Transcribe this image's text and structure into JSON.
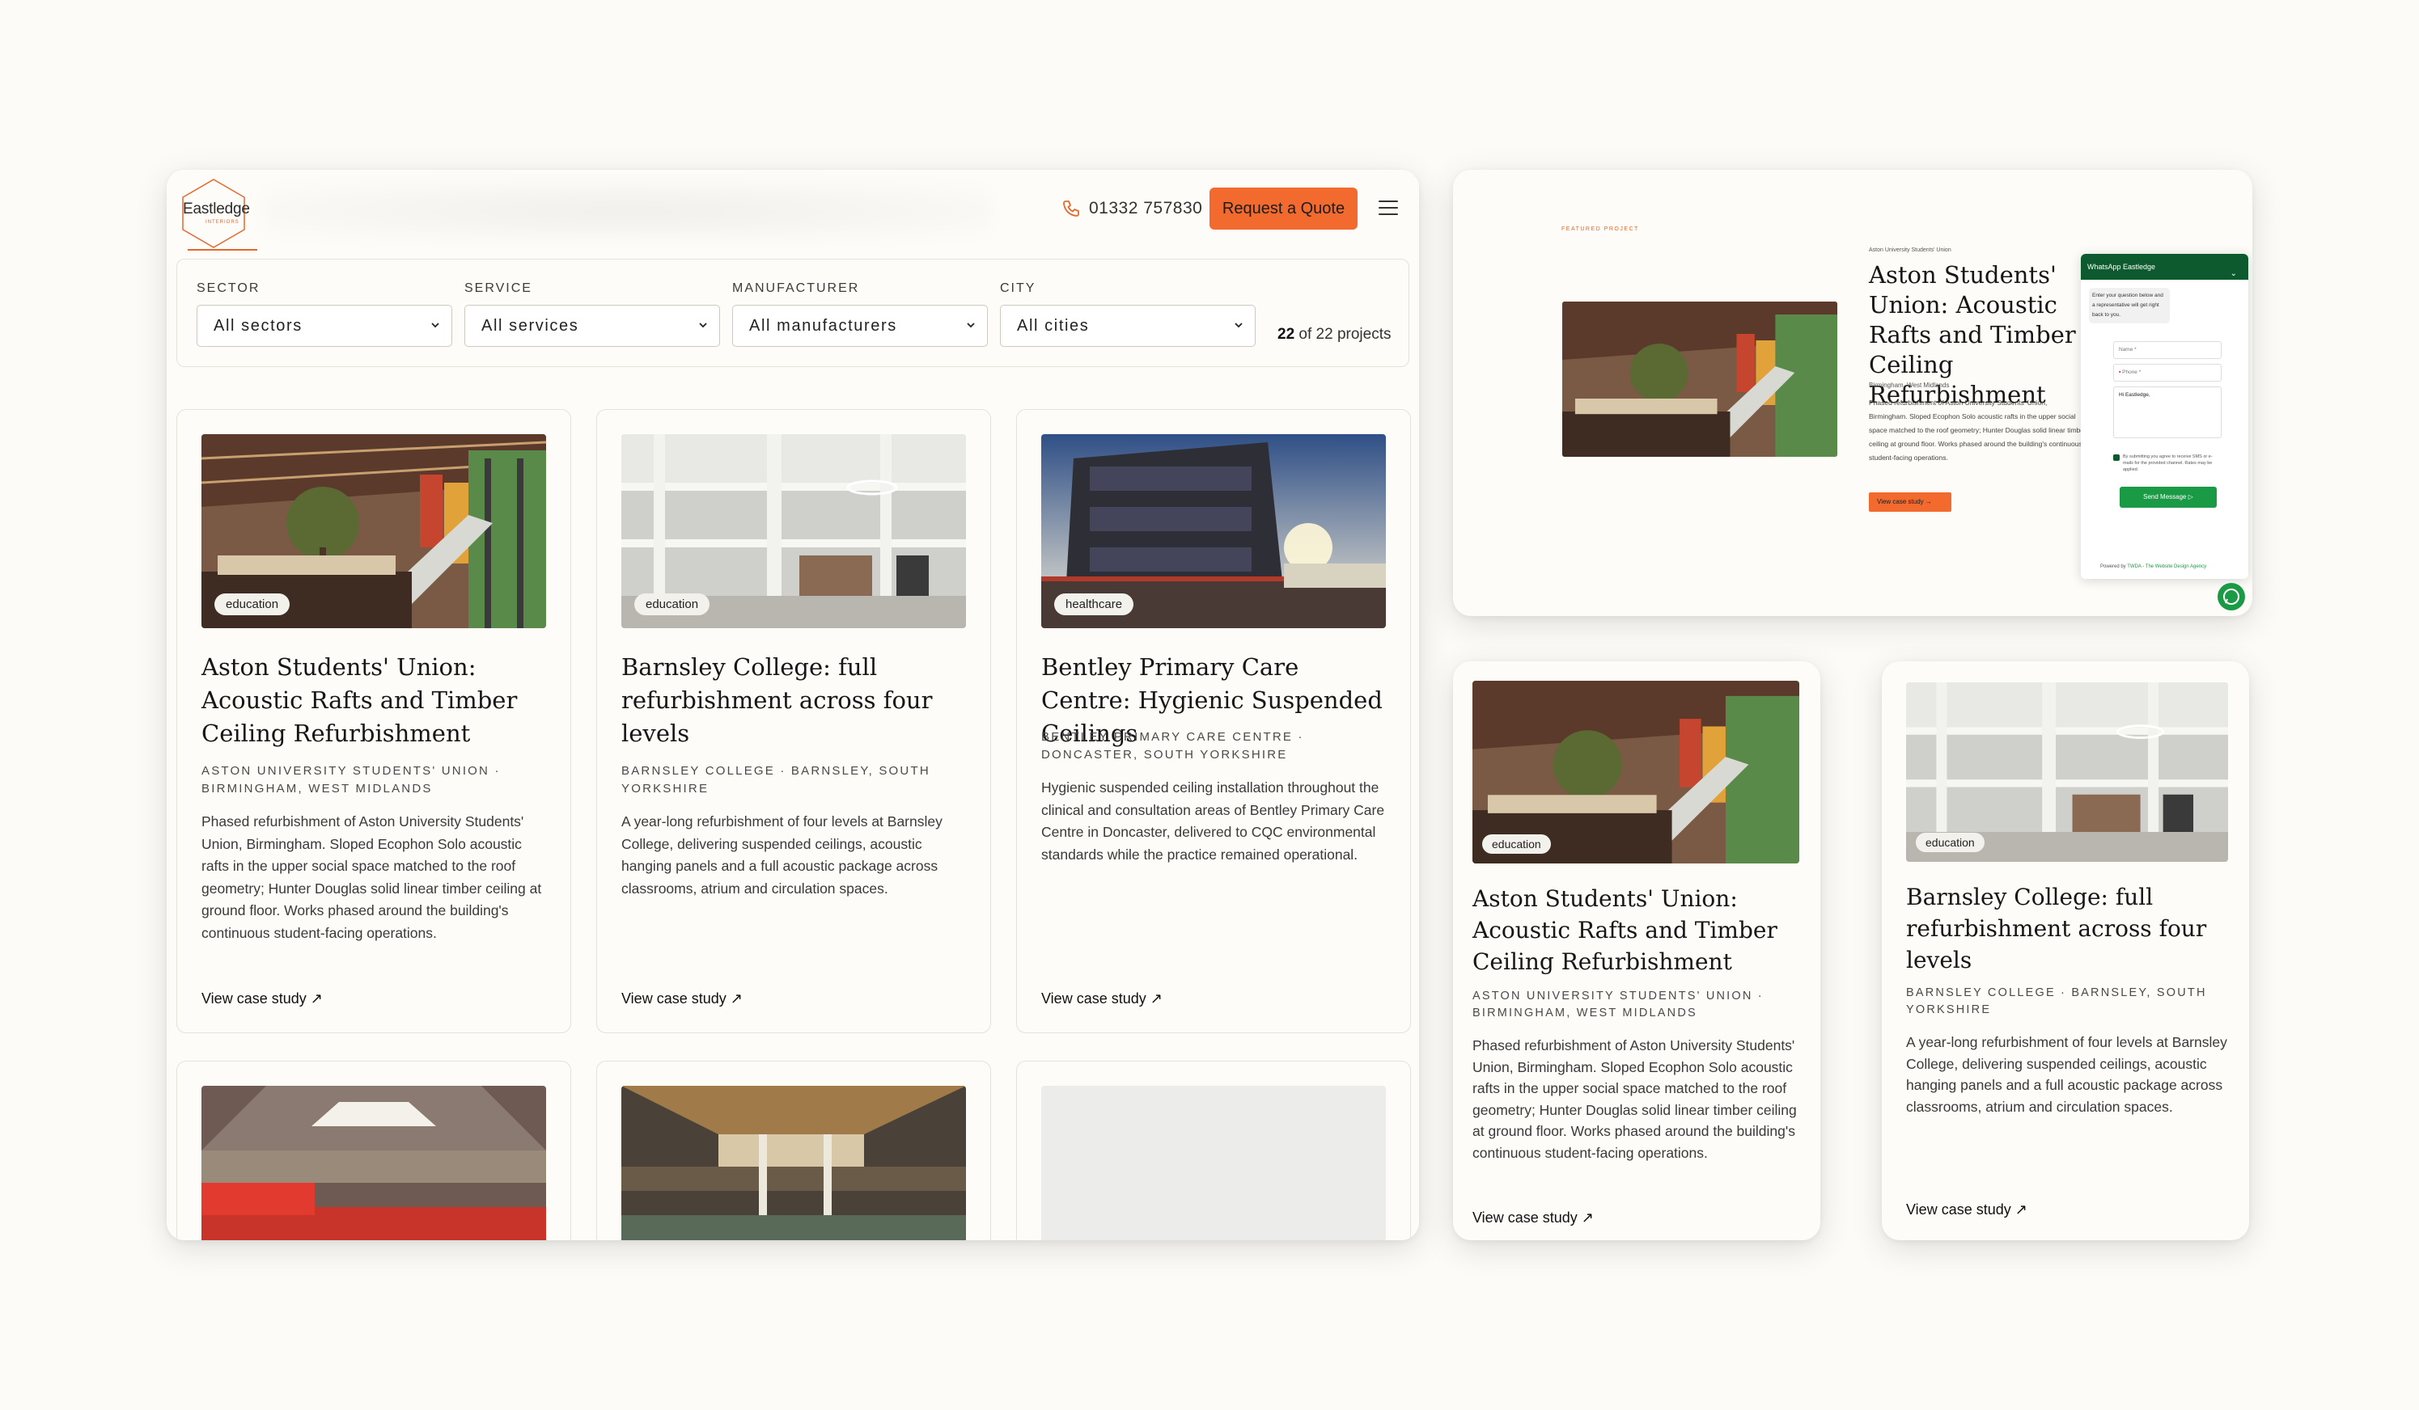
{
  "header": {
    "logo_text": "Eastledge",
    "logo_sub": "INTERIORS",
    "phone": "01332 757830",
    "cta": "Request a Quote"
  },
  "filters": {
    "sector": {
      "label": "SECTOR",
      "value": "All sectors"
    },
    "service": {
      "label": "SERVICE",
      "value": "All services"
    },
    "manufacturer": {
      "label": "MANUFACTURER",
      "value": "All manufacturers"
    },
    "city": {
      "label": "CITY",
      "value": "All cities"
    },
    "count": "22",
    "count_suffix": "of 22 projects"
  },
  "cards": [
    {
      "badge": "education",
      "title": "Aston Students' Union: Acoustic Rafts and Timber Ceiling Refurbishment",
      "meta": "ASTON UNIVERSITY STUDENTS' UNION · BIRMINGHAM, WEST MIDLANDS",
      "desc": "Phased refurbishment of Aston University Students' Union, Birmingham. Sloped Ecophon Solo acoustic rafts in the upper social space matched to the roof geometry; Hunter Douglas solid linear timber ceiling at ground floor. Works phased around the building's continuous student-facing operations.",
      "cta": "View case study ↗"
    },
    {
      "badge": "education",
      "title": "Barnsley College: full refurbishment across four levels",
      "meta": "BARNSLEY COLLEGE · BARNSLEY, SOUTH YORKSHIRE",
      "desc": "A year-long refurbishment of four levels at Barnsley College, delivering suspended ceilings, acoustic hanging panels and a full acoustic package across classrooms, atrium and circulation spaces.",
      "cta": "View case study ↗"
    },
    {
      "badge": "healthcare",
      "title": "Bentley Primary Care Centre: Hygienic Suspended Ceilings",
      "meta": "BENTLEY PRIMARY CARE CENTRE · DONCASTER, SOUTH YORKSHIRE",
      "desc": "Hygienic suspended ceiling installation throughout the clinical and consultation areas of Bentley Primary Care Centre in Doncaster, delivered to CQC environmental standards while the practice remained operational.",
      "cta": "View case study ↗"
    }
  ],
  "featured": {
    "kicker": "FEATURED PROJECT",
    "org": "Aston University Students' Union",
    "title": "Aston Students' Union: Acoustic Rafts and Timber Ceiling Refurbishment",
    "location": "Birmingham, West Midlands",
    "desc": "Phased refurbishment of Aston University Students' Union, Birmingham. Sloped Ecophon Solo acoustic rafts in the upper social space matched to the roof geometry; Hunter Douglas solid linear timber ceiling at ground floor. Works phased around the building's continuous student-facing operations.",
    "cta": "View case study →"
  },
  "whatsapp": {
    "title": "WhatsApp Eastledge",
    "intro": "Enter your question below and a representative will get right back to you.",
    "name_placeholder": "Name *",
    "phone_placeholder": "Phone *",
    "message_value": "Hi Eastledge,",
    "consent": "By submitting you agree to receive SMS or e-mails for the provided channel. Rates may be applied.",
    "send": "Send Message ▷",
    "powered": "Powered by",
    "powered_by": "TWDA - The Website Design Agency"
  },
  "colors": {
    "accent": "#f26a2e",
    "whatsapp_green": "#1a9a45",
    "background": "#fcfbf7"
  }
}
